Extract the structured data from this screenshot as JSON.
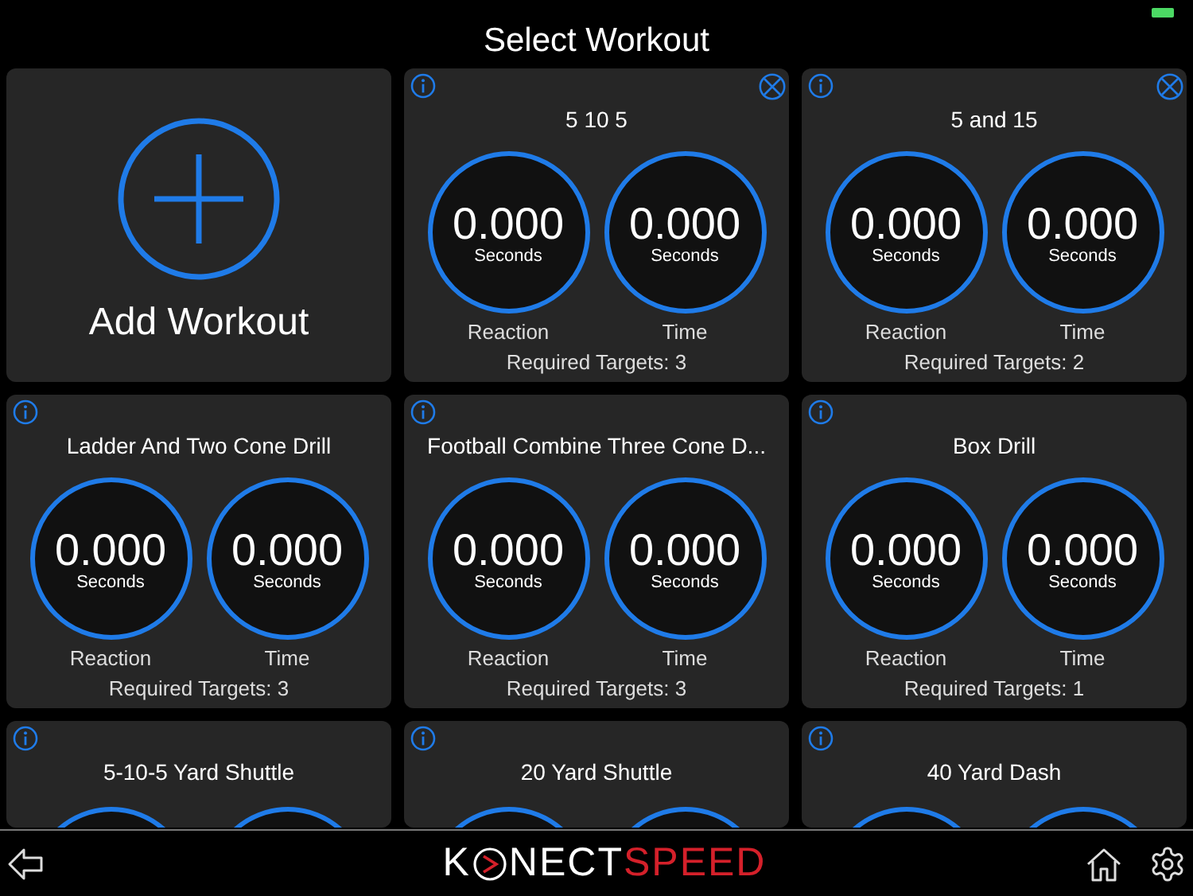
{
  "header": {
    "title": "Select Workout"
  },
  "add_card": {
    "label": "Add Workout"
  },
  "cards": [
    {
      "kind": "workout",
      "name": "5 10 5",
      "deletable": true,
      "gauges": [
        {
          "value": "0.000",
          "unit": "Seconds",
          "label": "Reaction"
        },
        {
          "value": "0.000",
          "unit": "Seconds",
          "label": "Time"
        }
      ],
      "targets": "Required Targets: 3"
    },
    {
      "kind": "workout",
      "name": "5 and 15",
      "deletable": true,
      "gauges": [
        {
          "value": "0.000",
          "unit": "Seconds",
          "label": "Reaction"
        },
        {
          "value": "0.000",
          "unit": "Seconds",
          "label": "Time"
        }
      ],
      "targets": "Required Targets: 2"
    },
    {
      "kind": "workout",
      "name": "Ladder And Two Cone Drill",
      "deletable": false,
      "gauges": [
        {
          "value": "0.000",
          "unit": "Seconds",
          "label": "Reaction"
        },
        {
          "value": "0.000",
          "unit": "Seconds",
          "label": "Time"
        }
      ],
      "targets": "Required Targets: 3"
    },
    {
      "kind": "workout",
      "name": "Football Combine Three Cone D...",
      "deletable": false,
      "gauges": [
        {
          "value": "0.000",
          "unit": "Seconds",
          "label": "Reaction"
        },
        {
          "value": "0.000",
          "unit": "Seconds",
          "label": "Time"
        }
      ],
      "targets": "Required Targets: 3"
    },
    {
      "kind": "workout",
      "name": "Box Drill",
      "deletable": false,
      "gauges": [
        {
          "value": "0.000",
          "unit": "Seconds",
          "label": "Reaction"
        },
        {
          "value": "0.000",
          "unit": "Seconds",
          "label": "Time"
        }
      ],
      "targets": "Required Targets: 1"
    },
    {
      "kind": "partial",
      "name": "5-10-5 Yard Shuttle",
      "deletable": false
    },
    {
      "kind": "partial",
      "name": "20 Yard Shuttle",
      "deletable": false
    },
    {
      "kind": "partial",
      "name": "40 Yard Dash",
      "deletable": false
    }
  ],
  "logo": {
    "first": "K",
    "middle": "NECT",
    "last": "SPEED"
  }
}
